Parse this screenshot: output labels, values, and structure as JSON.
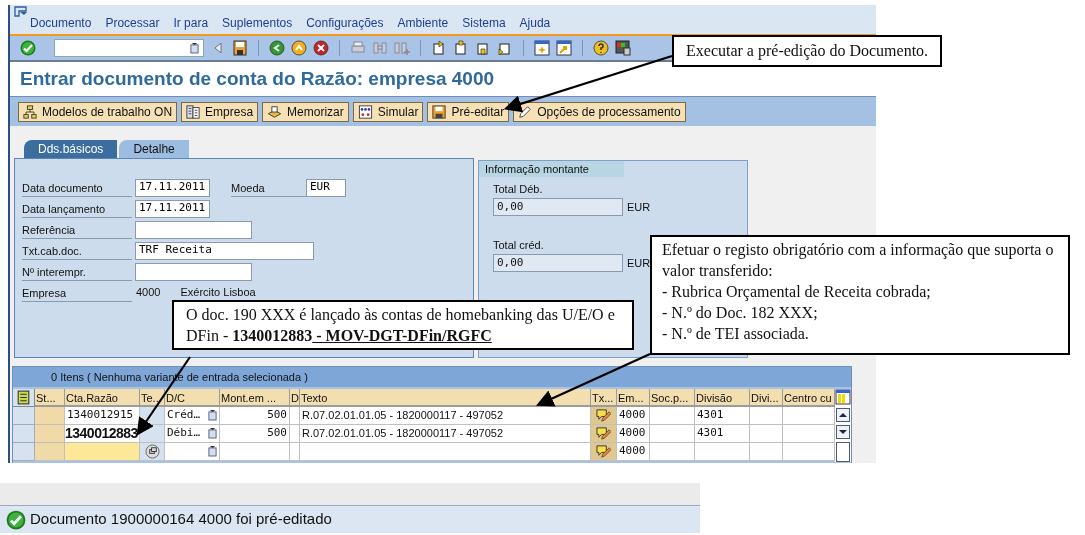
{
  "menu": [
    {
      "label": "Documento"
    },
    {
      "label": "Processar"
    },
    {
      "label": "Ir para"
    },
    {
      "label": "Suplementos"
    },
    {
      "label": "Configurações"
    },
    {
      "label": "Ambiente"
    },
    {
      "label": "Sistema"
    },
    {
      "label": "Ajuda"
    }
  ],
  "title": "Entrar documento de conta do Razão: empresa 4000",
  "app_buttons": [
    {
      "label": "Modelos de trabalho ON",
      "kind": "tree"
    },
    {
      "label": "Empresa",
      "kind": "list"
    },
    {
      "label": "Memorizar",
      "kind": "hold"
    },
    {
      "label": "Simular",
      "kind": "simulate"
    },
    {
      "label": "Pré-editar",
      "kind": "save"
    },
    {
      "label": "Opções de processamento",
      "kind": "pencil"
    }
  ],
  "tabs": [
    {
      "label": "Dds.básicos",
      "selected": true
    },
    {
      "label": "Detalhe",
      "selected": false
    }
  ],
  "form": [
    {
      "label": "Data documento",
      "value": "17.11.2011",
      "extra_label": "Moeda",
      "extra_value": "EUR"
    },
    {
      "label": "Data lançamento",
      "value": "17.11.2011"
    },
    {
      "label": "Referência"
    },
    {
      "label": "Txt.cab.doc.",
      "value": "TRF Receita"
    },
    {
      "label": "Nº interempr."
    },
    {
      "label": "Empresa",
      "value": "4000",
      "description": "Exército Lisboa"
    }
  ],
  "amount_info": {
    "title": "Informação montante",
    "totals": [
      {
        "label": "Total Déb.",
        "value": "0,00",
        "currency": "EUR"
      },
      {
        "label": "Total créd.",
        "value": "0,00",
        "currency": "EUR"
      }
    ]
  },
  "table": {
    "summary": "0 Itens ( Nenhuma variante de entrada selecionada )",
    "columns": [
      "St...",
      "Cta.Razão",
      "Te...",
      "D/C",
      "Mont.em ...",
      "D",
      "Texto",
      "Tx...",
      "Em...",
      "Soc.p...",
      "Divisão",
      "Divi...",
      "Centro cu"
    ],
    "rows": [
      {
        "account": "1340012915",
        "emphasized": false,
        "focused": false,
        "dc": "Créd…",
        "amount": "500",
        "text": "R.07.02.01.01.05 - 1820000117 - 497052",
        "company": "4000",
        "division": "4301"
      },
      {
        "account": "1340012883",
        "emphasized": true,
        "focused": false,
        "dc": "Débi…",
        "amount": "500",
        "text": "R.07.02.01.01.05 - 1820000117 - 497052",
        "company": "4000",
        "division": "4301"
      },
      {
        "focused": true,
        "emphasized": false,
        "company": "4000"
      }
    ]
  },
  "callouts": [
    {
      "kind": "plain",
      "text": "Executar a pré-edição do Documento."
    },
    {
      "kind": "account",
      "text": "O doc. 190 XXX é lançado às contas de homebanking das U/E/O e DFin - ",
      "code": "1340012883",
      "underlined": " - MOV-DGT-DFin/RGFC"
    },
    {
      "kind": "list",
      "lines": [
        "Efetuar o registo obrigatório com a informação que suporta o valor transferido:",
        "- Rubrica Orçamental de Receita cobrada;",
        "- N.º do Doc. 182 XXX;",
        "- N.º de TEI associada."
      ]
    }
  ],
  "status_bar": {
    "message": "Documento 1900000164 4000 foi pré-editado"
  }
}
